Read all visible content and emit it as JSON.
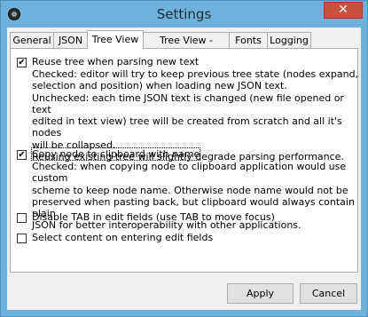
{
  "window": {
    "title": "Settings",
    "close_glyph": "✕"
  },
  "tabs": [
    {
      "label": "General"
    },
    {
      "label": "JSON"
    },
    {
      "label": "Tree View"
    },
    {
      "label": "Tree View - Colors"
    },
    {
      "label": "Fonts"
    },
    {
      "label": "Logging"
    }
  ],
  "active_tab": "Tree View",
  "options": [
    {
      "label": "Reuse tree when parsing new text",
      "checked": true,
      "description": "Checked: editor will try to keep previous tree state (nodes expand,\nselection and position) when loading new JSON text.\nUnchecked: each time JSON text is changed (new file opened or text\nedited in text view) tree will be created from scratch and all it's nodes\nwill be collapsed.\nReusing existing tree will slightly degrade parsing performance."
    },
    {
      "label": "Copy node to clipboard with name",
      "checked": true,
      "description": "Checked: when copying node to clipboard application would use custom\nscheme to keep node name. Otherwise node name would not be\npreserved when pasting back, but clipboard would always contain plain\nJSON for better interoperability with other applications."
    },
    {
      "label": "Disable TAB in edit fields (use TAB to move focus)",
      "checked": false
    },
    {
      "label": "Select content on entering edit fields",
      "checked": false
    }
  ],
  "buttons": {
    "apply": "Apply",
    "cancel": "Cancel"
  },
  "checkbox_glyph": "✔",
  "colors": {
    "titlebar": "#6fb1dd",
    "close": "#c7503f",
    "panel": "#ffffff",
    "dialog": "#f0f0f0"
  }
}
